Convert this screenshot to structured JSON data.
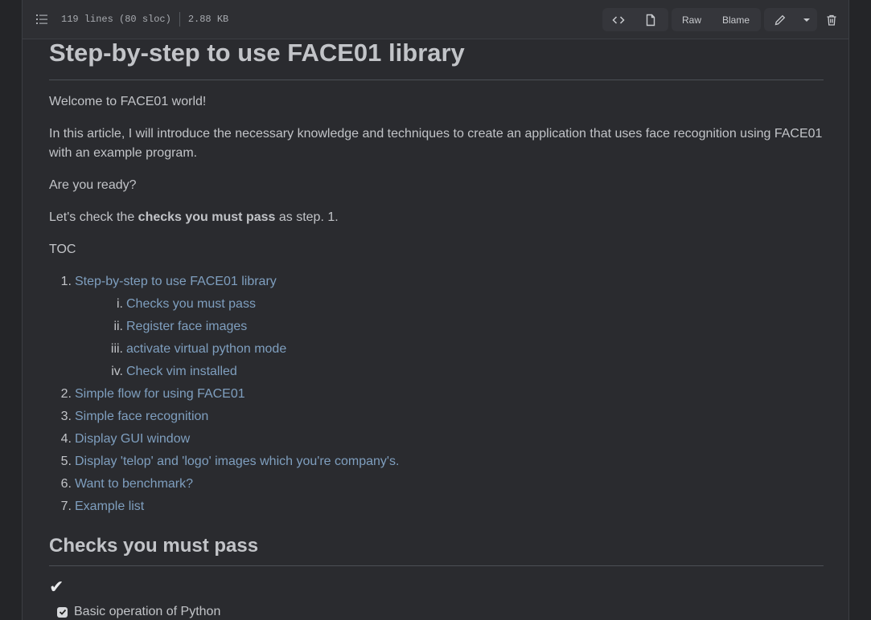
{
  "file_header": {
    "lines_info": "119 lines (80 sloc)",
    "size": "2.88 KB",
    "raw_label": "Raw",
    "blame_label": "Blame"
  },
  "article": {
    "title": "Step-by-step to use FACE01 library",
    "welcome": "Welcome to FACE01 world!",
    "intro": "In this article, I will introduce the necessary knowledge and techniques to create an application that uses face recognition using FACE01 with an example program.",
    "ready": "Are you ready?",
    "step_prefix": "Let's check the ",
    "step_bold": "checks you must pass",
    "step_suffix": " as step. 1.",
    "toc_label": "TOC",
    "toc": [
      {
        "num": "1.",
        "label": "Step-by-step to use FACE01 library",
        "children": [
          {
            "num": "i.",
            "label": "Checks you must pass"
          },
          {
            "num": "ii.",
            "label": "Register face images"
          },
          {
            "num": "iii.",
            "label": "activate virtual python mode"
          },
          {
            "num": "iv.",
            "label": "Check vim installed"
          }
        ]
      },
      {
        "num": "2.",
        "label": "Simple flow for using FACE01"
      },
      {
        "num": "3.",
        "label": "Simple face recognition"
      },
      {
        "num": "4.",
        "label": "Display GUI window"
      },
      {
        "num": "5.",
        "label": "Display 'telop' and 'logo' images which you're company's."
      },
      {
        "num": "6.",
        "label": "Want to benchmark?"
      },
      {
        "num": "7.",
        "label": "Example list"
      }
    ],
    "section_title": "Checks you must pass",
    "checkmark": "✔",
    "task_1": "Basic operation of Python"
  },
  "colors": {
    "link": "#7f9fbf",
    "background": "#2a2b2f"
  }
}
